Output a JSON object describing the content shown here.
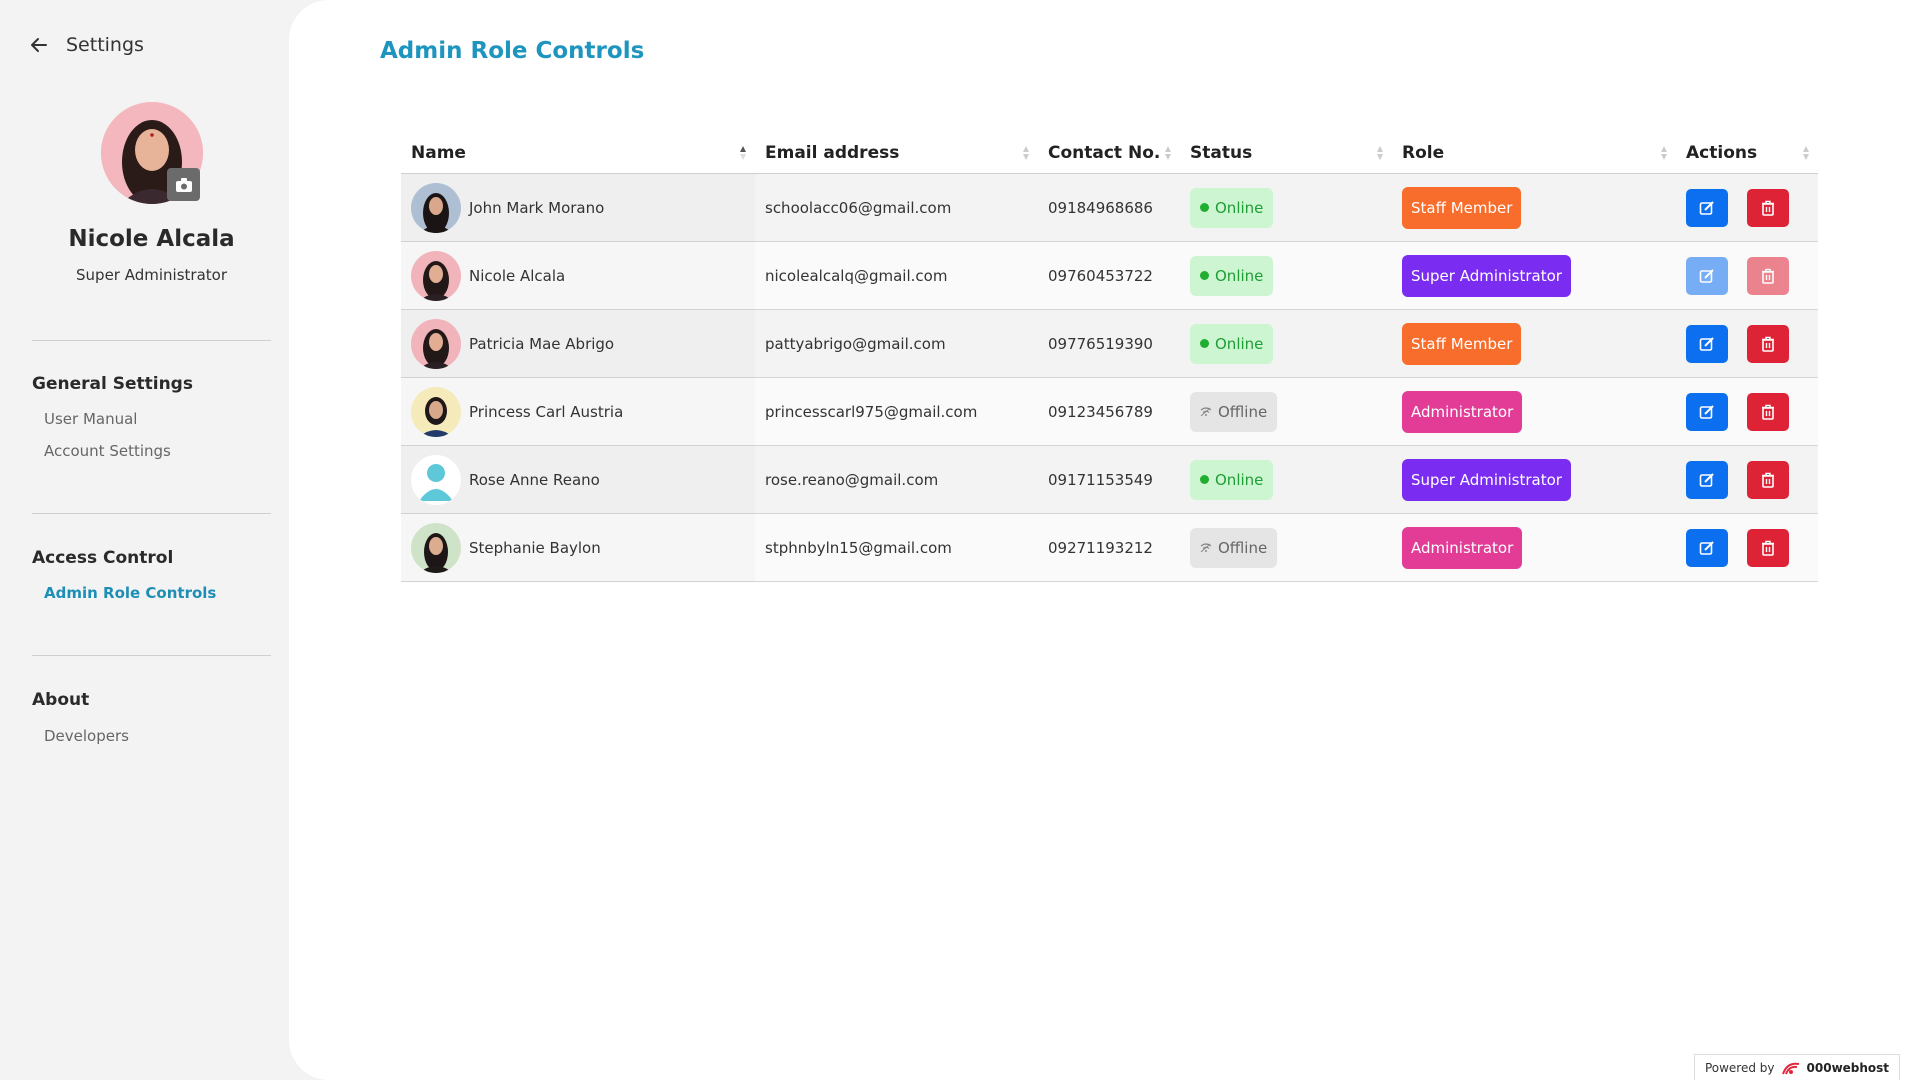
{
  "sidebar": {
    "back_label": "Settings",
    "profile": {
      "name": "Nicole Alcala",
      "role": "Super Administrator"
    },
    "sections": [
      {
        "title": "General Settings",
        "items": [
          "User Manual",
          "Account Settings"
        ]
      },
      {
        "title": "Access Control",
        "items": [
          "Admin Role Controls"
        ]
      },
      {
        "title": "About",
        "items": [
          "Developers"
        ]
      }
    ],
    "active_item": "Admin Role Controls"
  },
  "main": {
    "title": "Admin Role Controls",
    "columns": [
      "Name",
      "Email address",
      "Contact No.",
      "Status",
      "Role",
      "Actions"
    ],
    "rows": [
      {
        "name": "John Mark Morano",
        "email": "schoolacc06@gmail.com",
        "contact": "09184968686",
        "status": "Online",
        "role": "Staff Member",
        "avatar": "photo-dark-hair"
      },
      {
        "name": "Nicole Alcala",
        "email": "nicolealcalq@gmail.com",
        "contact": "09760453722",
        "status": "Online",
        "role": "Super Administrator",
        "avatar": "photo-pink-bg"
      },
      {
        "name": "Patricia Mae Abrigo",
        "email": "pattyabrigo@gmail.com",
        "contact": "09776519390",
        "status": "Online",
        "role": "Staff Member",
        "avatar": "photo-pink-bg"
      },
      {
        "name": "Princess Carl Austria",
        "email": "princesscarl975@gmail.com",
        "contact": "09123456789",
        "status": "Offline",
        "role": "Administrator",
        "avatar": "photo-yellow-bg"
      },
      {
        "name": "Rose Anne Reano",
        "email": "rose.reano@gmail.com",
        "contact": "09171153549",
        "status": "Online",
        "role": "Super Administrator",
        "avatar": "default-user-icon"
      },
      {
        "name": "Stephanie Baylon",
        "email": "stphnbyln15@gmail.com",
        "contact": "09271193212",
        "status": "Offline",
        "role": "Administrator",
        "avatar": "photo-green-bg"
      }
    ]
  },
  "footer": {
    "powered_by": "Powered by",
    "brand": "000webhost"
  },
  "colors": {
    "accent": "#1e95be",
    "staff": "#f86d2c",
    "super": "#7a2df0",
    "admin": "#e23c97",
    "edit": "#0b6ff0",
    "delete": "#df2337",
    "online_bg": "#cdf5d1",
    "offline_bg": "#e5e5e5"
  }
}
